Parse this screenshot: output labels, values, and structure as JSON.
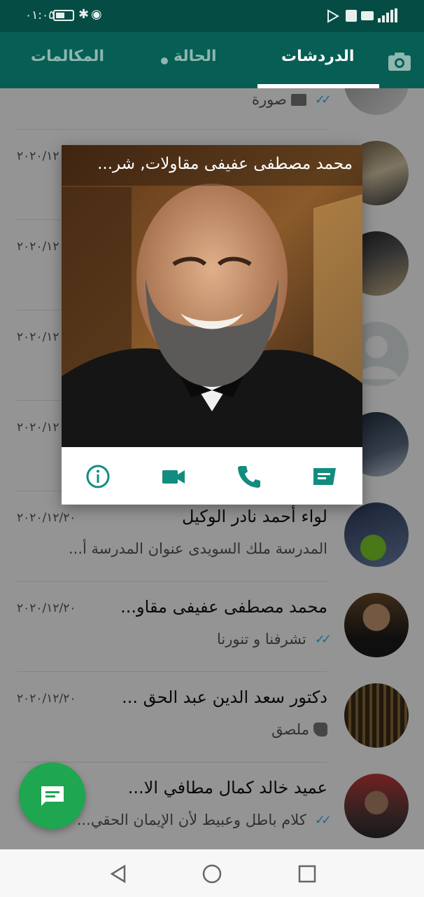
{
  "status_bar": {
    "time": "٠١:٠٥"
  },
  "tabs": {
    "chats": "الدردشات",
    "status": "الحالة",
    "calls": "المكالمات"
  },
  "colors": {
    "header": "#075e54",
    "status_bar": "#054d44",
    "accent": "#1ea650",
    "read_tick": "#34b7f1",
    "popup_icon": "#128c7e"
  },
  "chats": [
    {
      "name": "",
      "date": "",
      "preview": "صورة",
      "preview_icon": "image-icon",
      "read_ticks": true
    },
    {
      "name": "",
      "date": "٢٠٢٠/١٢",
      "preview": ""
    },
    {
      "name": "",
      "date": "٢٠٢٠/١٢",
      "preview": ""
    },
    {
      "name": "",
      "date": "٢٠٢٠/١٢",
      "preview": ""
    },
    {
      "name": "",
      "date": "٢٠٢٠/١٢",
      "preview": ""
    },
    {
      "name": "لواء أحمد نادر الوكيل",
      "date": "٢٠٢٠/١٢/٢٠",
      "preview": "المدرسة ملك  السويدى عنوان المدرسة أ...",
      "read_ticks": false
    },
    {
      "name": "محمد مصطفى عفيفى مقاو...",
      "date": "٢٠٢٠/١٢/٢٠",
      "preview": "تشرفنا و تنورنا",
      "read_ticks": true
    },
    {
      "name": "دكتور سعد الدين عبد الحق ...",
      "date": "٢٠٢٠/١٢/٢٠",
      "preview": "ملصق",
      "preview_icon": "sticker-icon",
      "read_ticks": false
    },
    {
      "name": "عميد خالد كمال مطافي الا...",
      "date": "",
      "preview": "كلام باطل وعبيط لأن الإيمان الحقي...",
      "read_ticks": true
    }
  ],
  "popup": {
    "contact_name": "محمد مصطفى عفيفى مقاولات, شر...",
    "actions": [
      "message-icon",
      "call-icon",
      "video-call-icon",
      "info-icon"
    ]
  },
  "fab": {
    "icon": "new-chat-icon"
  },
  "navbar": {
    "icons": [
      "back-icon",
      "home-icon",
      "recents-icon"
    ]
  }
}
